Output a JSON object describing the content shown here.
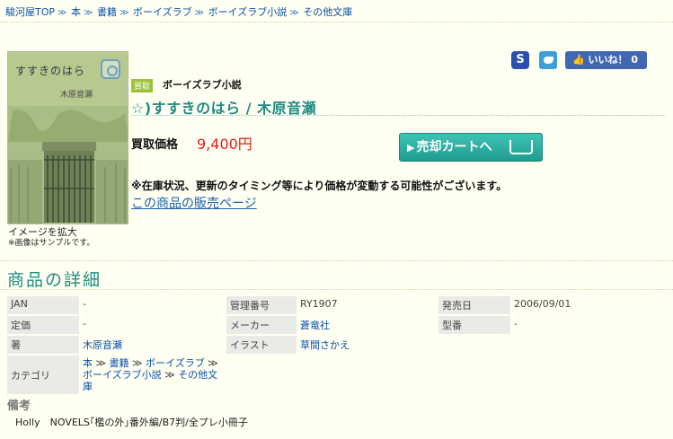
{
  "breadcrumb": {
    "items": [
      "駿河屋TOP",
      "本",
      "書籍",
      "ボーイズラブ",
      "ボーイズラブ小説",
      "その他文庫"
    ],
    "separator": "≫"
  },
  "social": {
    "s_label": "S",
    "like_label": "👍 いいね！ 0"
  },
  "product": {
    "cover_title": "すすきのはら",
    "cover_author": "木原音瀬",
    "image_caption": "イメージを拡大",
    "image_note": "※画像はサンプルです。",
    "badge": "買取",
    "category": "ボーイズラブ小説",
    "title": "☆)すすきのはら / 木原音瀬",
    "price_label": "買取価格",
    "price": "9,400円",
    "cart_button": "売却カートへ",
    "notice": "※在庫状況、更新のタイミング等により価格が変動する可能性がございます。",
    "sales_link": "この商品の販売ページ"
  },
  "details": {
    "title": "商品の詳細",
    "rows": [
      [
        {
          "label": "JAN",
          "value": "-"
        },
        {
          "label": "管理番号",
          "value": "RY1907"
        },
        {
          "label": "発売日",
          "value": "2006/09/01"
        }
      ],
      [
        {
          "label": "定価",
          "value": "-"
        },
        {
          "label": "メーカー",
          "value": "蒼竜社"
        },
        {
          "label": "型番",
          "value": "-"
        }
      ],
      [
        {
          "label": "著",
          "value": "木原音瀬"
        },
        {
          "label": "イラスト",
          "value": "草間さかえ"
        }
      ]
    ],
    "category_label": "カテゴリ",
    "category_path": [
      "本",
      "書籍",
      "ボーイズラブ",
      "ボーイズラブ小説",
      "その他文庫"
    ]
  },
  "remarks": {
    "title": "備考",
    "text": "Holly　NOVELS｢檻の外｣番外編/B7判/全プレ小冊子"
  },
  "colors": {
    "background": "#fffff2",
    "accent": "#1e8c84",
    "price": "#e02020",
    "link": "#0a4fa8"
  }
}
